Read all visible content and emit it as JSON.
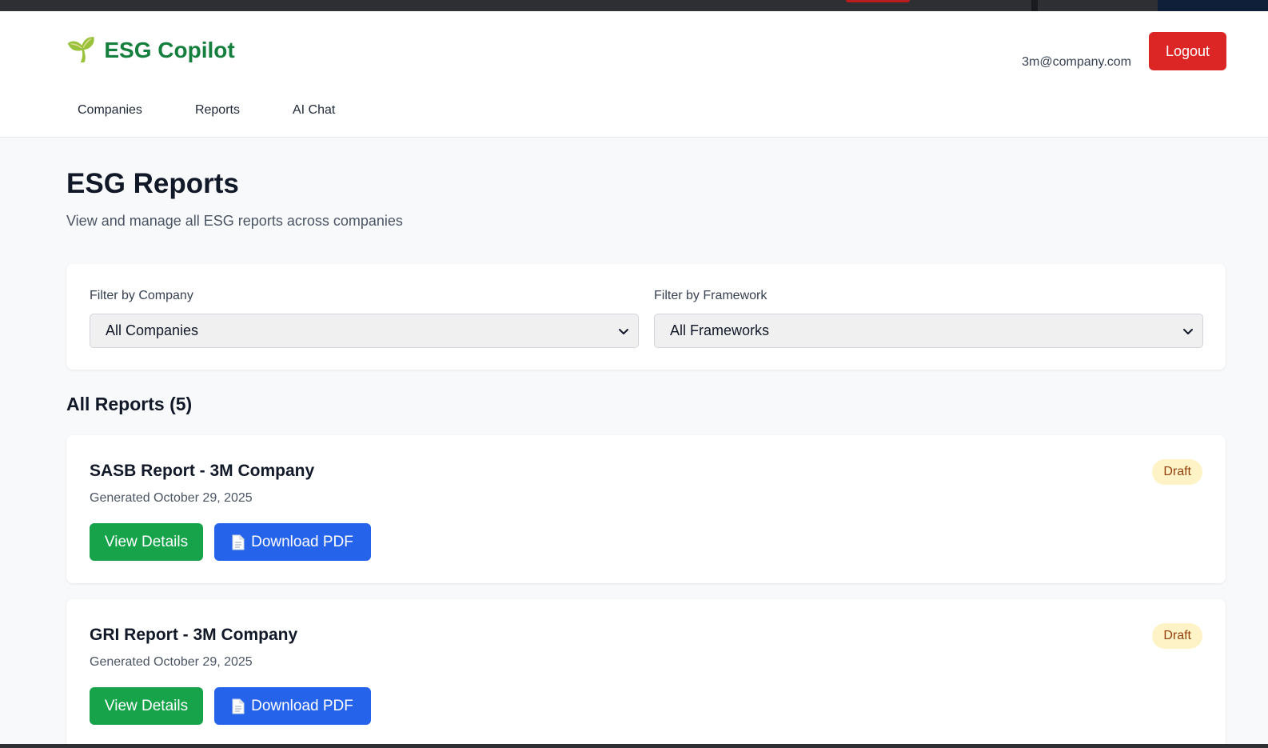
{
  "app": {
    "brand_icon": "seedling-icon",
    "brand_name": "ESG Copilot",
    "user_email": "3m@company.com",
    "logout_label": "Logout"
  },
  "nav": {
    "items": [
      {
        "label": "Companies"
      },
      {
        "label": "Reports"
      },
      {
        "label": "AI Chat"
      }
    ]
  },
  "page": {
    "title": "ESG Reports",
    "subtitle": "View and manage all ESG reports across companies"
  },
  "filters": {
    "company": {
      "label": "Filter by Company",
      "selected": "All Companies"
    },
    "framework": {
      "label": "Filter by Framework",
      "selected": "All Frameworks"
    }
  },
  "reports_section": {
    "title": "All Reports (5)"
  },
  "reports": [
    {
      "title": "SASB Report - 3M Company",
      "date": "Generated October 29, 2025",
      "status": "Draft",
      "view_label": "View Details",
      "download_label": "Download PDF"
    },
    {
      "title": "GRI Report - 3M Company",
      "date": "Generated October 29, 2025",
      "status": "Draft",
      "view_label": "View Details",
      "download_label": "Download PDF"
    }
  ],
  "colors": {
    "brand": "#15803d",
    "logout": "#dc2626",
    "primary_green": "#16a34a",
    "primary_blue": "#2563eb",
    "draft_bg": "#fef3c7",
    "draft_text": "#92400e"
  }
}
